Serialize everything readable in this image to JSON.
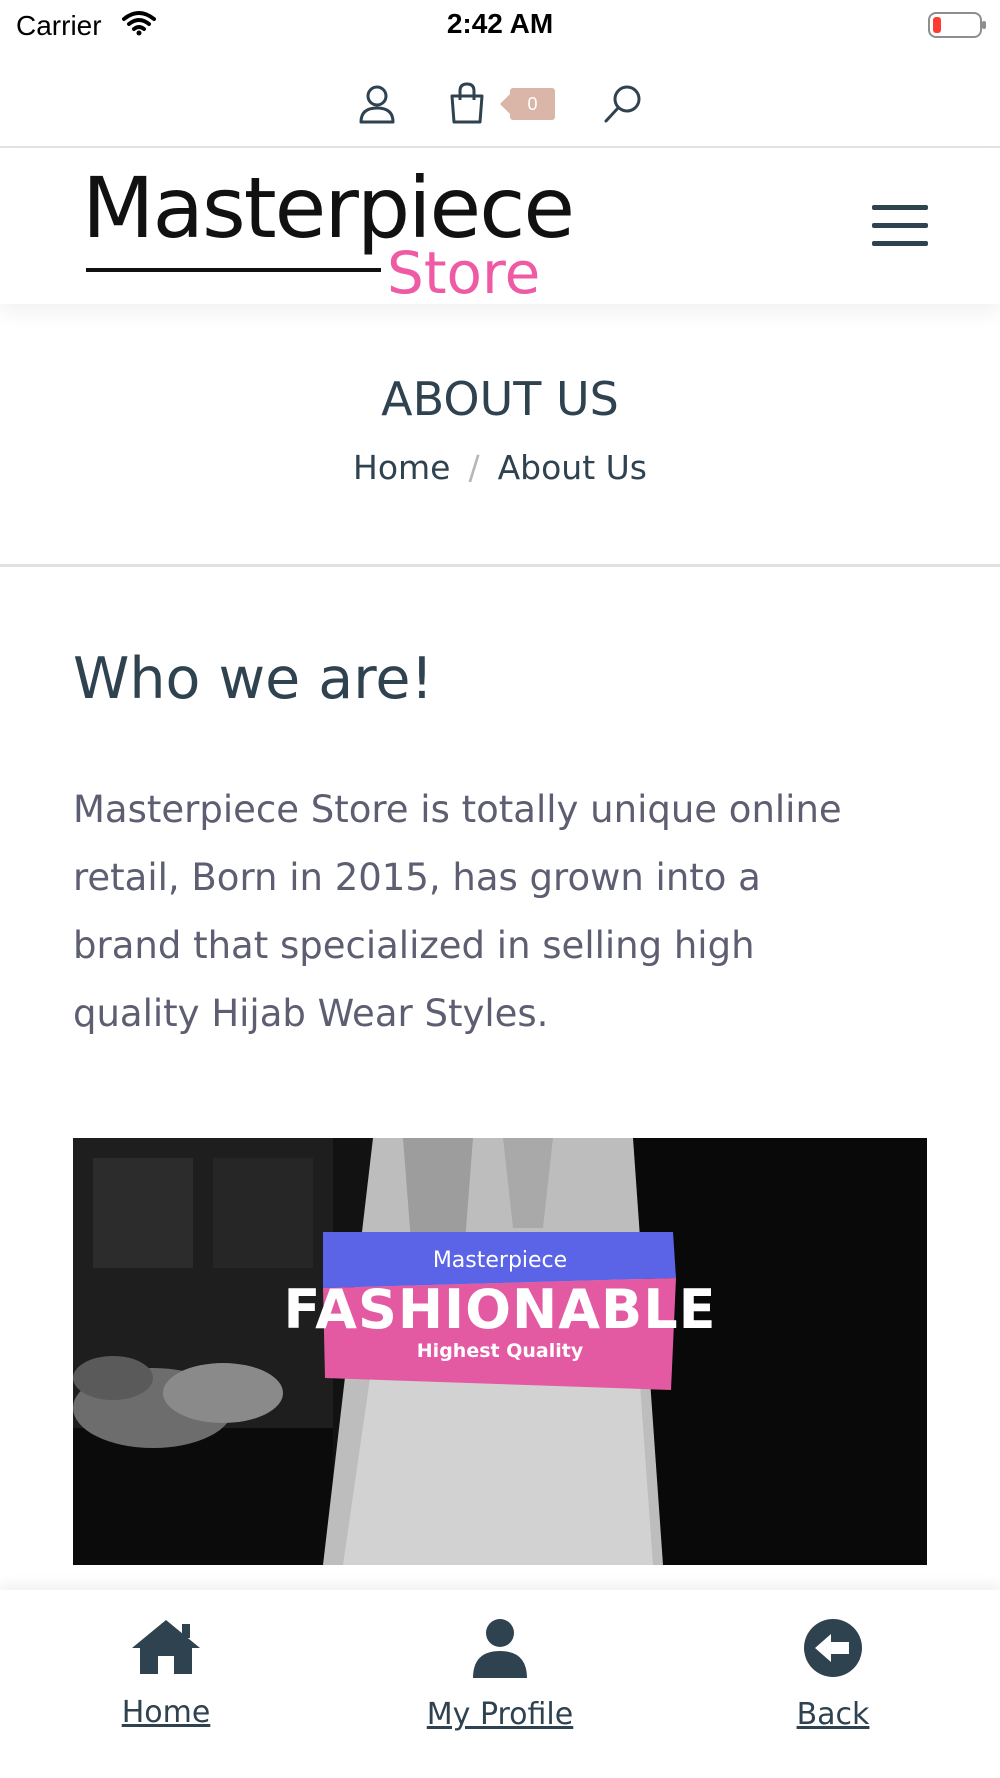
{
  "status_bar": {
    "carrier": "Carrier",
    "time": "2:42 AM"
  },
  "top_icons": {
    "cart_count": "0"
  },
  "logo": {
    "main": "Masterpiece",
    "sub": "Store"
  },
  "page": {
    "title": "ABOUT US",
    "breadcrumb": [
      "Home",
      "About Us"
    ],
    "breadcrumb_separator": "/"
  },
  "content": {
    "heading": "Who we are!",
    "paragraph": "Masterpiece Store is totally unique online retail, Born in 2015, has grown into a brand that specialized in selling high quality Hijab Wear Styles."
  },
  "banner": {
    "brand_small": "Masterpiece",
    "brand_big": "FASHIONABLE",
    "brand_sub": "Highest Quality"
  },
  "tabbar": {
    "home": "Home",
    "profile": "My Profile",
    "back": "Back"
  },
  "colors": {
    "accent_pink": "#ef5aa4",
    "text_dark": "#2f4250",
    "badge": "#d9b6a7",
    "banner_blue": "#5b64e6"
  },
  "icons": [
    "wifi-icon",
    "battery-icon",
    "user-icon",
    "cart-icon",
    "search-icon",
    "menu-icon",
    "home-icon",
    "profile-icon",
    "back-icon"
  ]
}
